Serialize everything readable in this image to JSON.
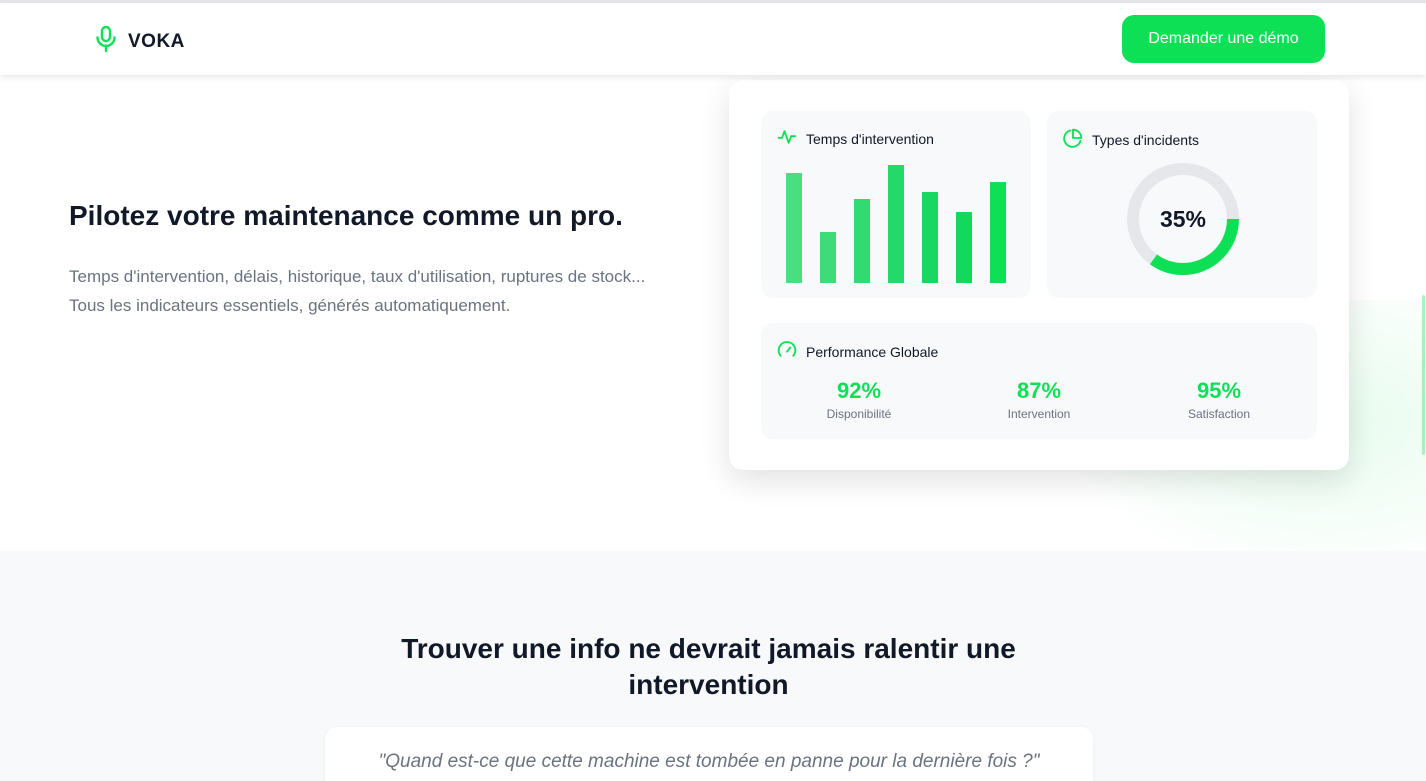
{
  "brand": {
    "name": "VOKA",
    "icon": "microphone-icon",
    "accent": "#0ee056"
  },
  "nav": {
    "demo_button": "Demander une démo"
  },
  "hero": {
    "title": "Pilotez votre maintenance comme un pro.",
    "line1": "Temps d'intervention, délais, historique, taux d'utilisation, ruptures de stock...",
    "line2": "Tous les indicateurs essentiels, générés automatiquement."
  },
  "dashboard": {
    "intervention": {
      "title": "Temps d'intervention",
      "icon": "activity-icon",
      "chart_data": {
        "type": "bar",
        "values": [
          93,
          43,
          71,
          100,
          77,
          60,
          86
        ],
        "colors": [
          "#4ade80",
          "#3ddc78",
          "#30db72",
          "#22d96a",
          "#18d862",
          "#12d85c",
          "#0ee056"
        ]
      }
    },
    "types": {
      "title": "Types d'incidents",
      "icon": "pie-chart-icon",
      "percent_label": "35%",
      "percent": 35
    },
    "performance": {
      "title": "Performance Globale",
      "icon": "gauge-icon",
      "metrics": [
        {
          "value": "92%",
          "label": "Disponibilité"
        },
        {
          "value": "87%",
          "label": "Intervention"
        },
        {
          "value": "95%",
          "label": "Satisfaction"
        }
      ]
    }
  },
  "section2": {
    "title_line1": "Trouver une info ne devrait jamais ralentir une",
    "title_line2": "intervention",
    "quote": "\"Quand est-ce que cette machine est tombée en panne pour la dernière fois ?\""
  }
}
